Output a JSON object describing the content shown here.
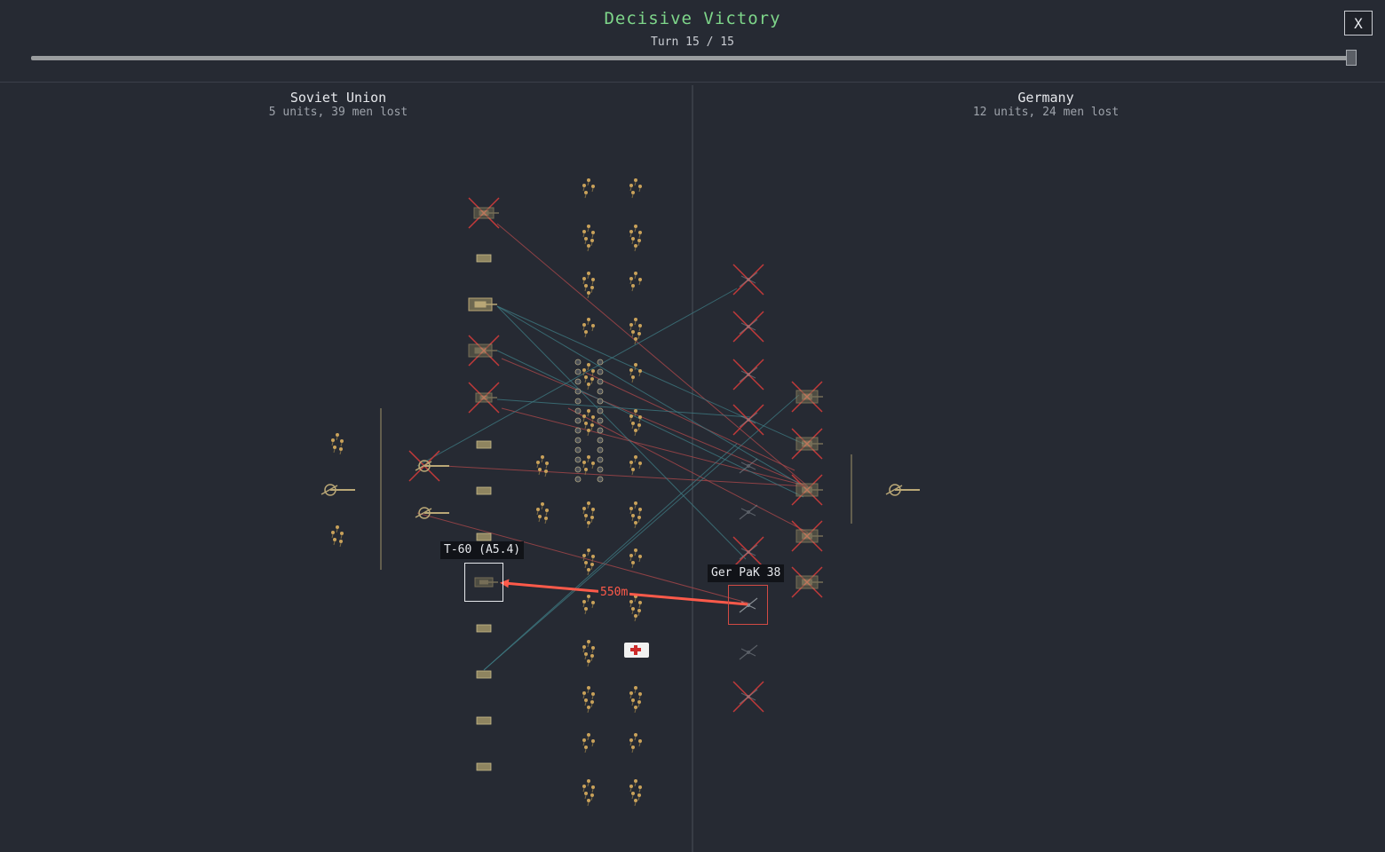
{
  "header": {
    "result_title": "Decisive Victory",
    "turn_label": "Turn 15 / 15",
    "turn_current": 15,
    "turn_total": 15,
    "close_label": "X"
  },
  "sides": {
    "left": {
      "name": "Soviet Union",
      "summary": "5 units, 39 men lost"
    },
    "right": {
      "name": "Germany",
      "summary": "12 units, 24 men lost"
    }
  },
  "selection": {
    "source_unit_label": "T-60 (A5.4)",
    "target_unit_label": "Ger PaK 38",
    "distance_label": "550m"
  },
  "colors": {
    "background": "#262a33",
    "victory_text": "#7ed68a",
    "attack_line": "#ff5a4a",
    "fire_line_red": "#a8474a",
    "fire_line_teal": "#3f7d85",
    "destroyed_cross": "#c23a3a",
    "unit_tan": "#b9a776",
    "infantry_orange": "#c9a25a"
  },
  "icons": {
    "close": "close-icon",
    "medic": "medic-truck-icon",
    "tank": "tank-icon",
    "artillery": "artillery-icon",
    "infantry": "infantry-icon"
  }
}
